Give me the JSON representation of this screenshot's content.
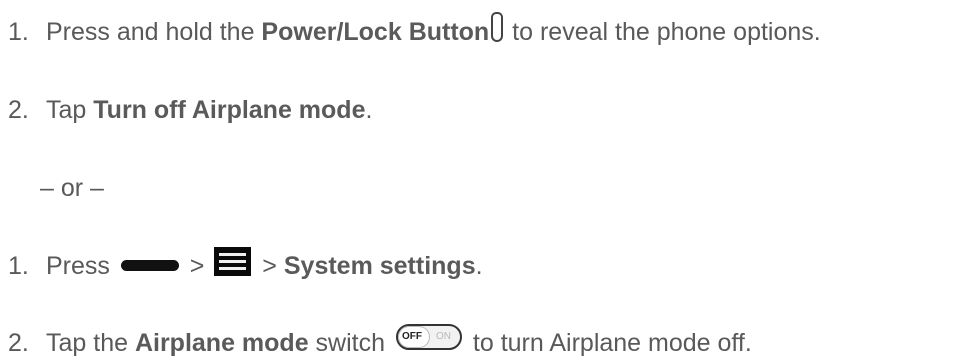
{
  "section1": {
    "step1": {
      "num": "1.",
      "pre": "Press and hold the ",
      "bold": "Power/Lock Button",
      "post": " to reveal the phone options.",
      "icon": "power-lock-button-icon"
    },
    "step2": {
      "num": "2.",
      "pre": "Tap ",
      "bold": "Turn off Airplane mode",
      "post": "."
    }
  },
  "separator": "– or –",
  "section2": {
    "step1": {
      "num": "1.",
      "pre": "Press ",
      "mid": " > ",
      "mid2": " > ",
      "bold": "System settings",
      "post": ".",
      "icons": [
        "home-key-icon",
        "menu-icon"
      ]
    },
    "step2": {
      "num": "2.",
      "pre": "Tap the ",
      "bold": "Airplane mode",
      "mid": " switch ",
      "post": " to turn Airplane mode off.",
      "toggle_off_label": "OFF",
      "toggle_on_label": "ON"
    }
  }
}
